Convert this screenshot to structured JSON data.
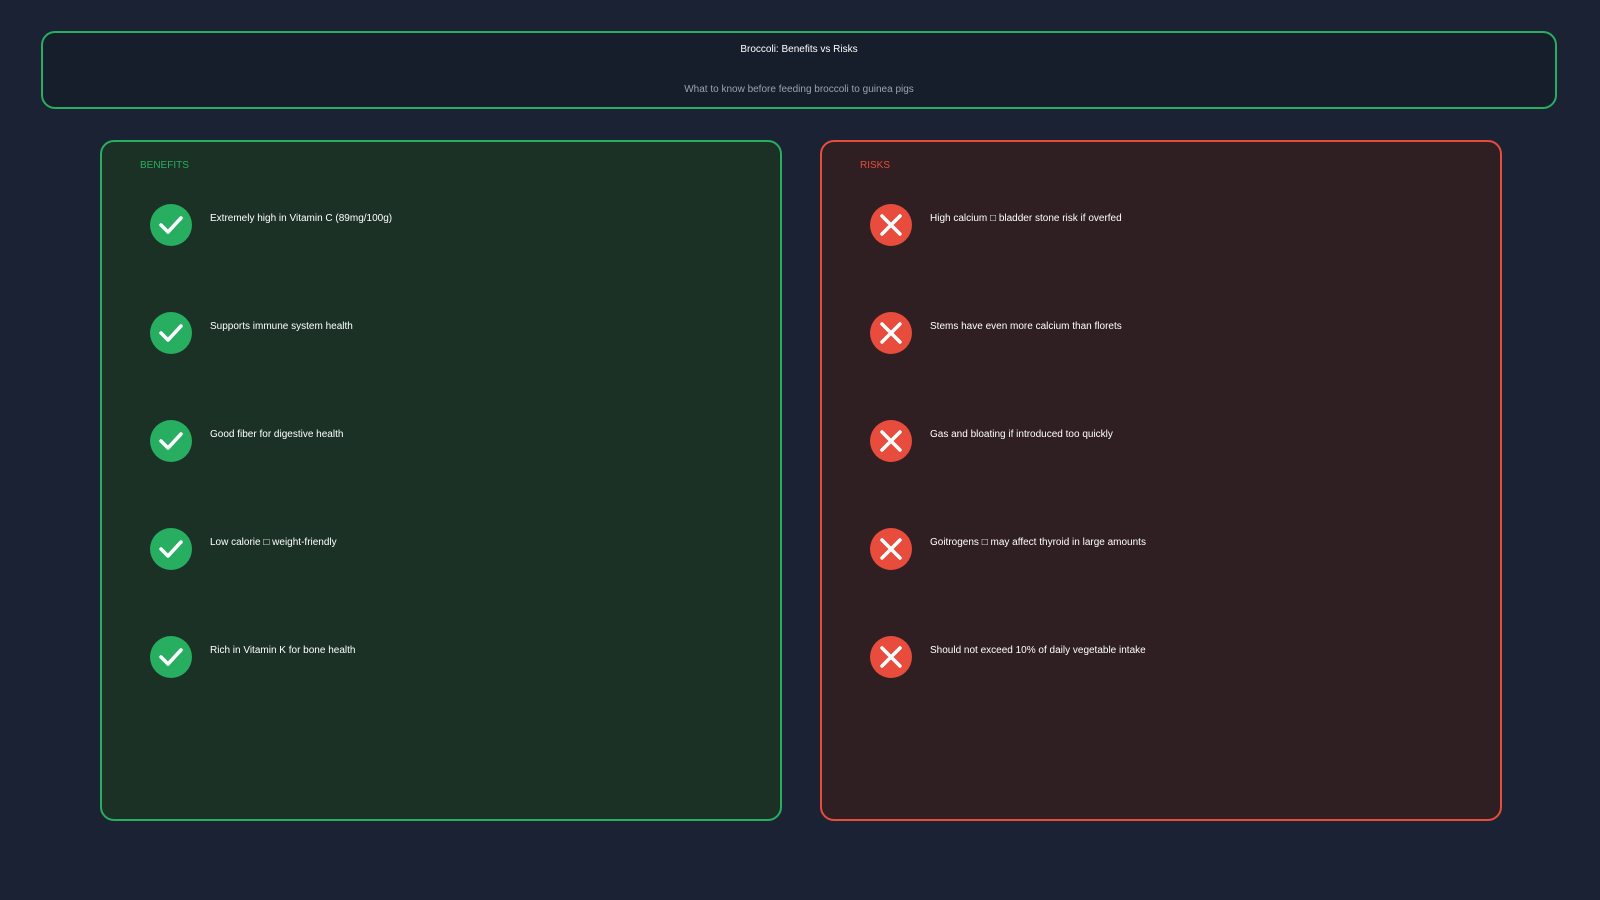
{
  "header": {
    "title": "Broccoli: Benefits vs Risks",
    "subtitle": "What to know before feeding broccoli to guinea pigs"
  },
  "benefits": {
    "heading": "BENEFITS",
    "accent_color": "#27ae60",
    "icon": "check-icon",
    "items": [
      "Extremely high in Vitamin C (89mg/100g)",
      "Supports immune system health",
      "Good fiber for digestive health",
      "Low calorie □ weight-friendly",
      "Rich in Vitamin K for bone health"
    ]
  },
  "risks": {
    "heading": "RISKS",
    "accent_color": "#e74c3c",
    "icon": "cross-icon",
    "items": [
      "High calcium □ bladder stone risk if overfed",
      "Stems have even more calcium than florets",
      "Gas and bloating if introduced too quickly",
      "Goitrogens □ may affect thyroid in large amounts",
      "Should not exceed 10% of daily vegetable intake"
    ]
  }
}
